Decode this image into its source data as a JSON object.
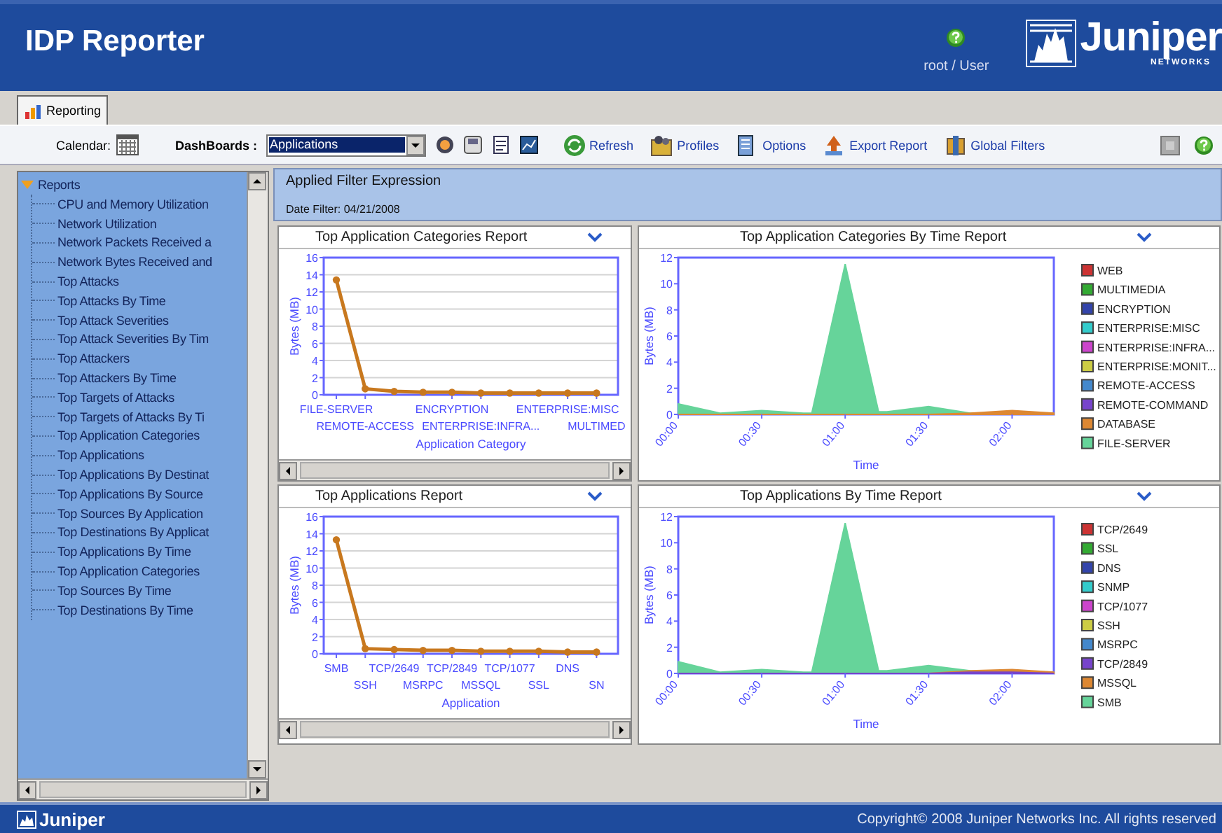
{
  "header": {
    "title": "IDP Reporter",
    "user": "root / User",
    "logo": {
      "name": "Juniper",
      "subtitle": "NETWORKS"
    }
  },
  "tabs": [
    {
      "label": "Reporting",
      "selected": true
    }
  ],
  "toolbar": {
    "calendar_label": "Calendar:",
    "dashboards_label": "DashBoards :",
    "dashboard_value": "Applications",
    "actions": [
      {
        "label": "Refresh"
      },
      {
        "label": "Profiles"
      },
      {
        "label": "Options"
      },
      {
        "label": "Export Report"
      },
      {
        "label": "Global Filters"
      }
    ]
  },
  "sidebar": {
    "tree": [
      {
        "label": "Reports",
        "expanded": true,
        "children": [
          {
            "label": "CPU and Memory Utilization"
          },
          {
            "label": "Network Utilization"
          },
          {
            "label": "Network Packets Received a"
          },
          {
            "label": "Network Bytes Received and"
          },
          {
            "label": "Top Attacks"
          },
          {
            "label": "Top Attacks By Time"
          },
          {
            "label": "Top Attack Severities"
          },
          {
            "label": "Top Attack Severities By Tim"
          },
          {
            "label": "Top Attackers"
          },
          {
            "label": "Top Attackers By Time"
          },
          {
            "label": "Top Targets of Attacks"
          },
          {
            "label": "Top Targets of Attacks By Ti"
          },
          {
            "label": "Top Application Categories"
          },
          {
            "label": "Top Applications"
          },
          {
            "label": "Top Applications By Destinat"
          },
          {
            "label": "Top Applications By Source"
          },
          {
            "label": "Top Sources By Application"
          },
          {
            "label": "Top Destinations By Applicat"
          },
          {
            "label": "Top Applications By Time"
          },
          {
            "label": "Top Application Categories"
          },
          {
            "label": "Top Sources By Time"
          },
          {
            "label": "Top Destinations By Time"
          }
        ]
      }
    ]
  },
  "filter": {
    "legend": "Applied Filter Expression",
    "text": "Date Filter: 04/21/2008"
  },
  "panels": [
    {
      "title": "Top Application Categories Report",
      "chart_data": {
        "type": "line",
        "xlabel": "Application Category",
        "ylabel": "Bytes (MB)",
        "grid": true,
        "marker": true,
        "categories": [
          "FILE-SERVER",
          "REMOTE-ACCESS",
          null,
          null,
          "ENCRYPTION",
          "ENTERPRISE:INFRA...",
          null,
          null,
          "ENTERPRISE:MISC",
          "MULTIMED"
        ],
        "values": [
          13.4,
          0.7,
          0.4,
          0.3,
          0.3,
          0.2,
          0.2,
          0.2,
          0.2,
          0.2
        ],
        "ylim": [
          0,
          16
        ],
        "yticks": [
          0,
          2,
          4,
          6,
          8,
          10,
          12,
          14,
          16
        ]
      }
    },
    {
      "title": "Top Application Categories By Time Report",
      "chart_data": {
        "type": "area",
        "xlabel": "Time",
        "ylabel": "Bytes (MB)",
        "x": [
          0,
          15,
          30,
          45,
          48,
          60,
          72,
          75,
          90,
          105,
          120,
          135
        ],
        "xlim": [
          0,
          135
        ],
        "xticks": [
          {
            "value": 0,
            "label": "00:00"
          },
          {
            "value": 30,
            "label": "00:30"
          },
          {
            "value": 60,
            "label": "01:00"
          },
          {
            "value": 90,
            "label": "01:30"
          },
          {
            "value": 120,
            "label": "02:00"
          }
        ],
        "ylim": [
          0,
          12
        ],
        "yticks": [
          0,
          2,
          4,
          6,
          8,
          10,
          12
        ],
        "legend": "right",
        "series": [
          {
            "name": "FILE-SERVER",
            "color": "#66d49a",
            "values": [
              0.8,
              0.1,
              0.3,
              0.1,
              0.1,
              11.5,
              0.2,
              0.2,
              0.6,
              0.1,
              0.1,
              0.1
            ]
          },
          {
            "name": "DATABASE",
            "color": "#dd8833",
            "values": [
              0,
              0,
              0,
              0,
              0,
              0,
              0,
              0,
              0,
              0.1,
              0.3,
              0.1
            ]
          }
        ]
      },
      "legend_items": [
        {
          "name": "WEB",
          "color": "#cc3333"
        },
        {
          "name": "MULTIMEDIA",
          "color": "#33aa33"
        },
        {
          "name": "ENCRYPTION",
          "color": "#3344aa"
        },
        {
          "name": "ENTERPRISE:MISC",
          "color": "#33cccc"
        },
        {
          "name": "ENTERPRISE:INFRA...",
          "color": "#cc44cc"
        },
        {
          "name": "ENTERPRISE:MONIT...",
          "color": "#cccc44"
        },
        {
          "name": "REMOTE-ACCESS",
          "color": "#4488cc"
        },
        {
          "name": "REMOTE-COMMAND",
          "color": "#7744cc"
        },
        {
          "kind": "series"
        },
        {
          "kind": "series"
        }
      ]
    },
    {
      "title": "Top Applications Report",
      "chart_data": {
        "type": "line",
        "xlabel": "Application",
        "ylabel": "Bytes (MB)",
        "grid": true,
        "marker": true,
        "categories": [
          "SMB",
          "SSH",
          "TCP/2649",
          "MSRPC",
          "TCP/2849",
          "MSSQL",
          "TCP/1077",
          "SSL",
          "DNS",
          "SN"
        ],
        "values": [
          13.3,
          0.6,
          0.5,
          0.4,
          0.4,
          0.3,
          0.3,
          0.3,
          0.2,
          0.2
        ],
        "ylim": [
          0,
          16
        ],
        "yticks": [
          0,
          2,
          4,
          6,
          8,
          10,
          12,
          14,
          16
        ]
      }
    },
    {
      "title": "Top Applications By Time Report",
      "chart_data": {
        "type": "area",
        "xlabel": "Time",
        "ylabel": "Bytes (MB)",
        "x": [
          0,
          15,
          30,
          45,
          48,
          60,
          72,
          75,
          90,
          105,
          120,
          135
        ],
        "xlim": [
          0,
          135
        ],
        "xticks": [
          {
            "value": 0,
            "label": "00:00"
          },
          {
            "value": 30,
            "label": "00:30"
          },
          {
            "value": 60,
            "label": "01:00"
          },
          {
            "value": 90,
            "label": "01:30"
          },
          {
            "value": 120,
            "label": "02:00"
          }
        ],
        "ylim": [
          0,
          12
        ],
        "yticks": [
          0,
          2,
          4,
          6,
          8,
          10,
          12
        ],
        "legend": "right",
        "series": [
          {
            "name": "SMB",
            "color": "#66d49a",
            "values": [
              0.9,
              0.1,
              0.3,
              0.1,
              0.1,
              11.5,
              0.2,
              0.2,
              0.6,
              0.2,
              0.1,
              0.1
            ]
          },
          {
            "name": "MSSQL",
            "color": "#dd8833",
            "values": [
              0,
              0,
              0,
              0,
              0,
              0,
              0,
              0,
              0,
              0.2,
              0.3,
              0.1
            ]
          },
          {
            "name": "TCP/2849",
            "color": "#7744cc",
            "values": [
              0,
              0,
              0,
              0,
              0,
              0,
              0,
              0,
              0,
              0.1,
              0.1,
              0
            ]
          }
        ]
      },
      "legend_items": [
        {
          "name": "TCP/2649",
          "color": "#cc3333"
        },
        {
          "name": "SSL",
          "color": "#33aa33"
        },
        {
          "name": "DNS",
          "color": "#3344aa"
        },
        {
          "name": "SNMP",
          "color": "#33cccc"
        },
        {
          "name": "TCP/1077",
          "color": "#cc44cc"
        },
        {
          "name": "SSH",
          "color": "#cccc44"
        },
        {
          "name": "MSRPC",
          "color": "#4488cc"
        },
        {
          "kind": "series"
        },
        {
          "kind": "series"
        },
        {
          "kind": "series"
        }
      ]
    }
  ],
  "footer": {
    "logo": "Juniper",
    "copyright": "Copyright© 2008 Juniper Networks Inc. All rights reserved"
  }
}
